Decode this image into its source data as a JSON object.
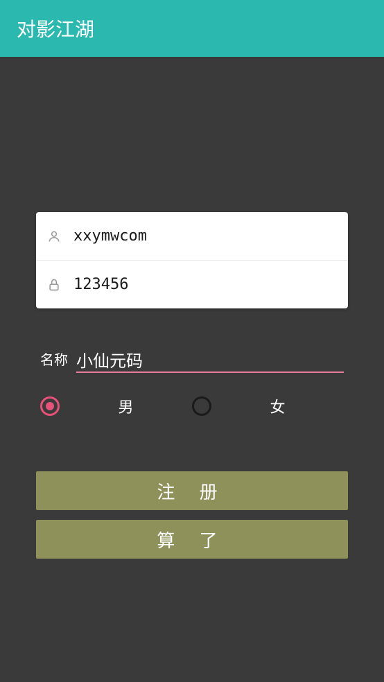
{
  "header": {
    "title": "对影江湖"
  },
  "form": {
    "username": "xxymwcom",
    "password": "123456",
    "name_label": "名称",
    "name_value": "小仙元码",
    "gender": {
      "male_label": "男",
      "female_label": "女",
      "selected": "male"
    }
  },
  "buttons": {
    "register": "注 册",
    "cancel": "算 了"
  },
  "colors": {
    "header_bg": "#2bb8ae",
    "body_bg": "#3a3a3a",
    "button_bg": "#8f915a",
    "accent": "#e8517a"
  }
}
